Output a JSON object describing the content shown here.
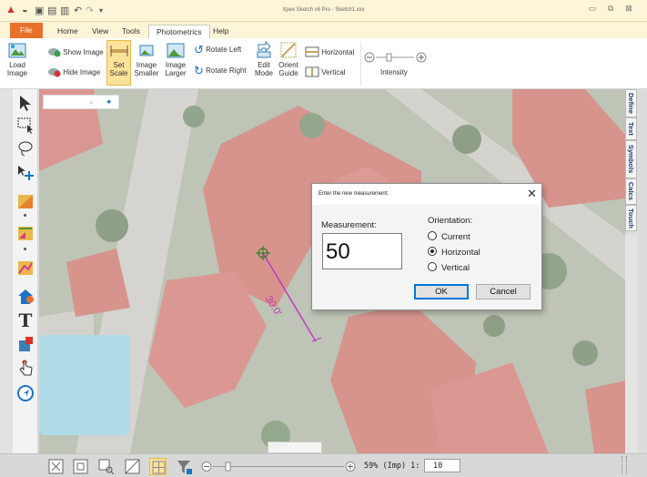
{
  "titlebar": {
    "title": "Xpex Sketch v6 Pro - Sketch1.xxx"
  },
  "menu": {
    "tabs": [
      "File",
      "Home",
      "View",
      "Tools",
      "Photometrics",
      "Help"
    ],
    "active": "Photometrics"
  },
  "ribbon": {
    "load_image": "Load Image",
    "show_image": "Show Image",
    "hide_image": "Hide Image",
    "set_scale": "Set Scale",
    "image_smaller": "Image Smaller",
    "image_larger": "Image Larger",
    "rotate_left": "Rotate Left",
    "rotate_right": "Rotate Right",
    "edit_mode": "Edit Mode",
    "orient_guide": "Orient Guide",
    "horizontal": "Horizontal",
    "vertical": "Vertical",
    "intensity": "Intensity"
  },
  "side_tabs": [
    "Define",
    "Text",
    "Symbols",
    "Calcs",
    "Touch"
  ],
  "map": {
    "measure_label": "30.0'"
  },
  "dialog": {
    "title": "Enter the new measurement:",
    "measurement_label": "Measurement:",
    "measurement_value": "50",
    "orientation_label": "Orientation:",
    "options": [
      "Current",
      "Horizontal",
      "Vertical"
    ],
    "selected": "Horizontal",
    "ok": "OK",
    "cancel": "Cancel"
  },
  "statusbar": {
    "zoom": "59% (Imp) 1:",
    "scale": "10"
  },
  "colors": {
    "accent": "#e8702a",
    "title_bg": "#fdf5d8",
    "measure_line": "#c03cc0",
    "selected_button": "#fde29a"
  }
}
